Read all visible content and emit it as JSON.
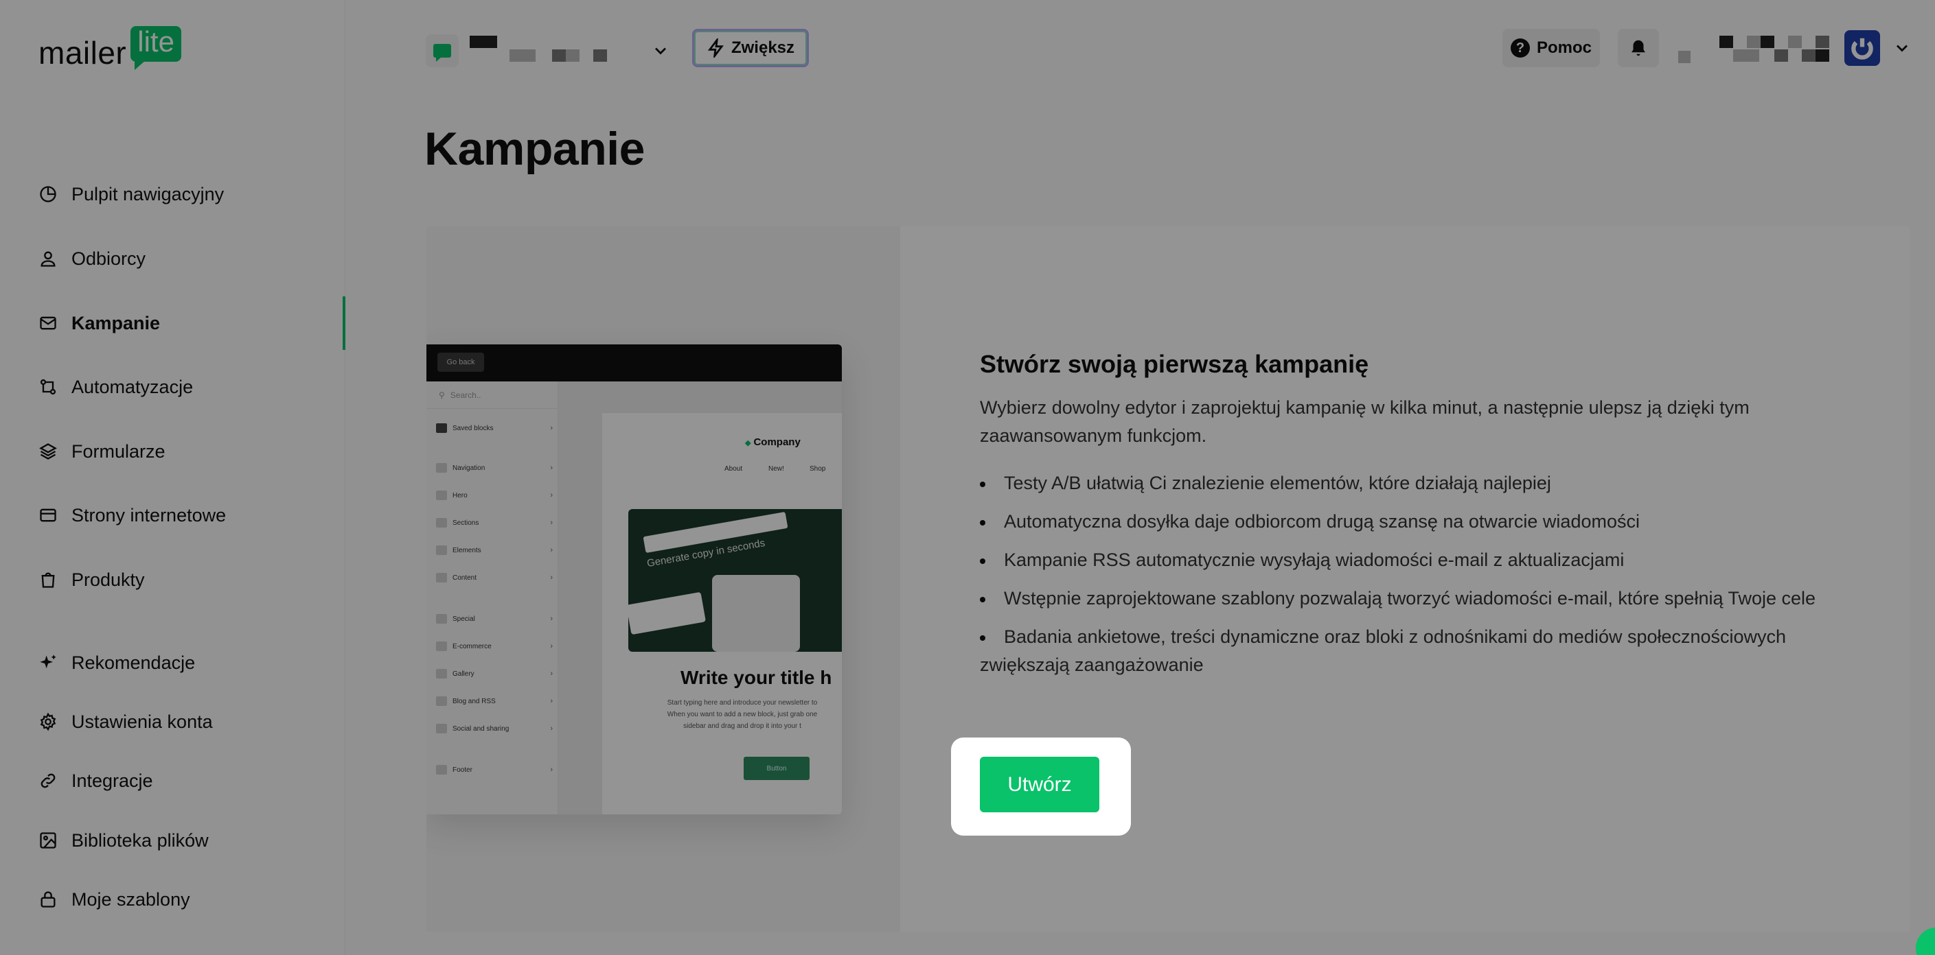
{
  "app": {
    "logo_main": "mailer",
    "logo_box": "lite"
  },
  "sidebar": {
    "items": [
      {
        "label": "Pulpit nawigacyjny",
        "icon": "pie-chart-icon"
      },
      {
        "label": "Odbiorcy",
        "icon": "user-icon"
      },
      {
        "label": "Kampanie",
        "icon": "mail-icon",
        "active": true
      },
      {
        "label": "Automatyzacje",
        "icon": "automation-icon"
      },
      {
        "label": "Formularze",
        "icon": "layers-icon"
      },
      {
        "label": "Strony internetowe",
        "icon": "browser-icon"
      },
      {
        "label": "Produkty",
        "icon": "shopping-bag-icon"
      },
      {
        "label": "Rekomendacje",
        "icon": "sparkle-icon"
      },
      {
        "label": "Ustawienia konta",
        "icon": "gear-icon"
      },
      {
        "label": "Integracje",
        "icon": "link-icon"
      },
      {
        "label": "Biblioteka plików",
        "icon": "image-icon"
      },
      {
        "label": "Moje szablony",
        "icon": "lock-icon"
      }
    ]
  },
  "header": {
    "boost_label": "Zwiększ",
    "help_label": "Pomoc",
    "help_glyph": "?"
  },
  "page": {
    "title": "Kampanie"
  },
  "empty_state": {
    "title": "Stwórz swoją pierwszą kampanię",
    "description": "Wybierz dowolny edytor i zaprojektuj kampanię w kilka minut, a następnie ulepsz ją dzięki tym zaawansowanym funkcjom.",
    "features": [
      "Testy A/B ułatwią Ci znalezienie elementów, które działają najlepiej",
      "Automatyczna dosyłka daje odbiorcom drugą szansę na otwarcie wiadomości",
      "Kampanie RSS automatycznie wysyłają wiadomości e-mail z aktualizacjami",
      "Wstępnie zaprojektowane szablony pozwalają tworzyć wiadomości e-mail, które spełnią Twoje cele",
      "Badania ankietowe, treści dynamiczne oraz bloki z odnośnikami do mediów społecznościowych zwiększają zaangażowanie"
    ],
    "create_label": "Utwórz"
  },
  "preview": {
    "back": "Go back",
    "search": "Search..",
    "blocks": [
      "Saved blocks",
      "Navigation",
      "Hero",
      "Sections",
      "Elements",
      "Content",
      "Special",
      "E-commerce",
      "Gallery",
      "Blog and RSS",
      "Social and sharing",
      "Footer"
    ],
    "company": "Company",
    "nav": [
      "About",
      "New!",
      "Shop"
    ],
    "hero_text": "Generate copy in seconds",
    "headline": "Write your title h",
    "body": [
      "Start typing here and introduce your newsletter to",
      "When you want to add a new block, just grab one",
      "sidebar and drag and drop it into your t"
    ],
    "button": "Button"
  },
  "colors": {
    "brand": "#09c269",
    "avatar": "#1f3fa8",
    "overlay": "rgba(0,0,0,0.42)"
  }
}
